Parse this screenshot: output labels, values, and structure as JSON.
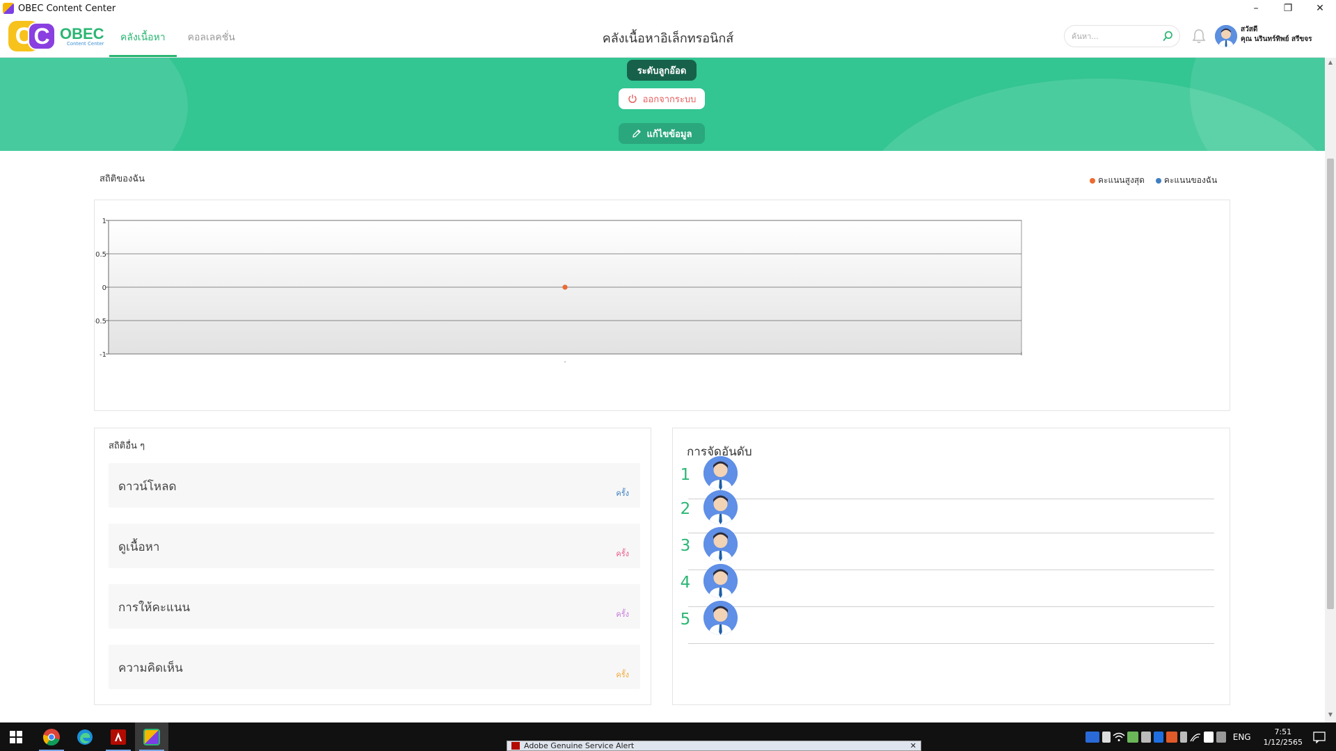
{
  "window": {
    "title": "OBEC Content Center",
    "minimize": "–",
    "restore": "❐",
    "close": "✕"
  },
  "header": {
    "logo_main": "OBEC",
    "logo_sub": "Content Center",
    "tabs": [
      {
        "label": "คลังเนื้อหา",
        "active": true
      },
      {
        "label": "คอลเลคชั่น",
        "active": false
      }
    ],
    "page_title": "คลังเนื้อหาอิเล็กทรอนิกส์",
    "search_placeholder": "ค้นหา...",
    "user_greeting": "สวัสดี",
    "user_name": "คุณ นรินทร์ทิพย์ สรีขจร"
  },
  "hero": {
    "level_label": "ระดับลูกอ๊อด",
    "logout_label": "ออกจากระบบ",
    "edit_label": "แก้ไขข้อมูล"
  },
  "stats": {
    "title": "สถิติของฉัน",
    "legend": [
      {
        "label": "คะแนนสูงสุด",
        "color": "#ee6a2f"
      },
      {
        "label": "คะแนนของฉัน",
        "color": "#3f7fc0"
      }
    ]
  },
  "chart_data": {
    "type": "line",
    "x": [
      ""
    ],
    "series": [
      {
        "name": "คะแนนสูงสุด",
        "values": [
          0
        ],
        "color": "#ee6a2f"
      },
      {
        "name": "คะแนนของฉัน",
        "values": [
          0
        ],
        "color": "#3f7fc0"
      }
    ],
    "ylim": [
      -1,
      1
    ],
    "yticks": [
      "1",
      "0.5",
      "0",
      "-0.5",
      "-1"
    ],
    "yticks_values": [
      1,
      0.5,
      0,
      -0.5,
      -1
    ],
    "grid": true
  },
  "other_stats": {
    "title": "สถิติอื่น ๆ",
    "items": [
      {
        "label": "ดาวน์โหลด",
        "unit": "ครั้ง",
        "color": "#3f7fc0"
      },
      {
        "label": "ดูเนื้อหา",
        "unit": "ครั้ง",
        "color": "#e85d8a"
      },
      {
        "label": "การให้คะแนน",
        "unit": "ครั้ง",
        "color": "#c77ddc"
      },
      {
        "label": "ความคิดเห็น",
        "unit": "ครั้ง",
        "color": "#f0a93b"
      }
    ]
  },
  "ranking": {
    "title": "การจัดอันดับ",
    "items": [
      {
        "rank": "1"
      },
      {
        "rank": "2"
      },
      {
        "rank": "3"
      },
      {
        "rank": "4"
      },
      {
        "rank": "5"
      }
    ]
  },
  "taskbar": {
    "alert_title": "Adobe Genuine Service Alert",
    "language": "ENG",
    "time": "7:51",
    "date": "1/12/2565"
  }
}
